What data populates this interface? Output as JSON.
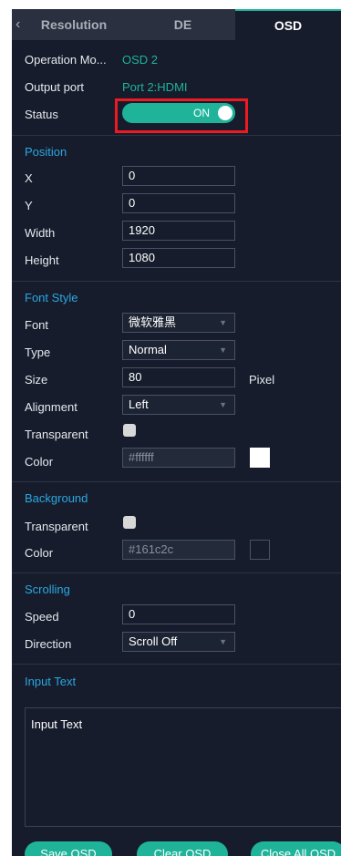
{
  "tabs": [
    {
      "label": "Resolution"
    },
    {
      "label": "DE"
    },
    {
      "label": "OSD"
    }
  ],
  "back_icon": "chevron-left-icon",
  "info": {
    "operation_mode_label": "Operation Mo...",
    "operation_mode_value": "OSD 2",
    "output_port_label": "Output port",
    "output_port_value": "Port 2:HDMI",
    "status_label": "Status",
    "status_toggle": "ON"
  },
  "position": {
    "title": "Position",
    "x_label": "X",
    "x_value": "0",
    "y_label": "Y",
    "y_value": "0",
    "width_label": "Width",
    "width_value": "1920",
    "height_label": "Height",
    "height_value": "1080"
  },
  "font_style": {
    "title": "Font Style",
    "font_label": "Font",
    "font_value": "微软雅黑",
    "type_label": "Type",
    "type_value": "Normal",
    "size_label": "Size",
    "size_value": "80",
    "size_unit": "Pixel",
    "alignment_label": "Alignment",
    "alignment_value": "Left",
    "transparent_label": "Transparent",
    "color_label": "Color",
    "color_value": "#ffffff"
  },
  "background": {
    "title": "Background",
    "transparent_label": "Transparent",
    "color_label": "Color",
    "color_value": "#161c2c"
  },
  "scrolling": {
    "title": "Scrolling",
    "speed_label": "Speed",
    "speed_value": "0",
    "direction_label": "Direction",
    "direction_value": "Scroll Off"
  },
  "input_text": {
    "title": "Input Text",
    "value": "Input Text"
  },
  "buttons": {
    "save": "Save OSD",
    "clear": "Clear OSD",
    "close_all": "Close All OSD"
  },
  "colors": {
    "accent": "#1fb39a",
    "section": "#2aa8e0",
    "panel_bg": "#161c2c",
    "highlight": "#ee1a22"
  }
}
